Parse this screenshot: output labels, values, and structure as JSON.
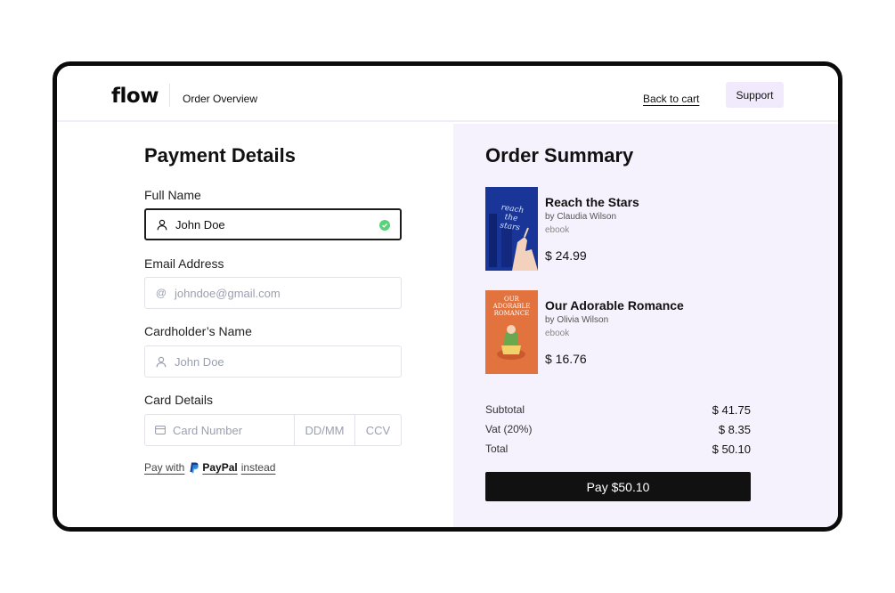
{
  "header": {
    "logo": "flow",
    "breadcrumb": "Order Overview",
    "back_link": "Back to cart",
    "support_button": "Support"
  },
  "payment": {
    "title": "Payment Details",
    "full_name": {
      "label": "Full Name",
      "value": "John Doe",
      "valid": true,
      "icon": "user-icon"
    },
    "email": {
      "label": "Email Address",
      "placeholder": "johndoe@gmail.com",
      "icon": "at-icon"
    },
    "cardholder": {
      "label": "Cardholder’s Name",
      "placeholder": "John Doe",
      "icon": "user-icon"
    },
    "card": {
      "label": "Card Details",
      "number_placeholder": "Card Number",
      "date_placeholder": "DD/MM",
      "cvv_placeholder": "CCV",
      "icon": "credit-card-icon"
    },
    "paypal": {
      "prefix": "Pay with",
      "brand": "PayPal",
      "suffix": "instead"
    }
  },
  "summary": {
    "title": "Order Summary",
    "items": [
      {
        "title": "Reach the Stars",
        "author": "by Claudia Wilson",
        "format": "ebook",
        "price": "$ 24.99",
        "cover_text": "reach the stars",
        "cover_color": "#1d3aa5"
      },
      {
        "title": "Our Adorable Romance",
        "author": "by Olivia Wilson",
        "format": "ebook",
        "price": "$ 16.76",
        "cover_text": "OUR ADORABLE ROMANCE",
        "cover_color": "#e2733e"
      }
    ],
    "subtotal": {
      "label": "Subtotal",
      "value": "$ 41.75"
    },
    "vat": {
      "label": "Vat (20%)",
      "value": "$ 8.35"
    },
    "total": {
      "label": "Total",
      "value": "$ 50.10"
    },
    "pay_button": "Pay $50.10"
  },
  "colors": {
    "accent_bg": "#f6f2fd",
    "support_bg": "#f1eafc",
    "valid": "#5ad27a",
    "button": "#111111"
  }
}
